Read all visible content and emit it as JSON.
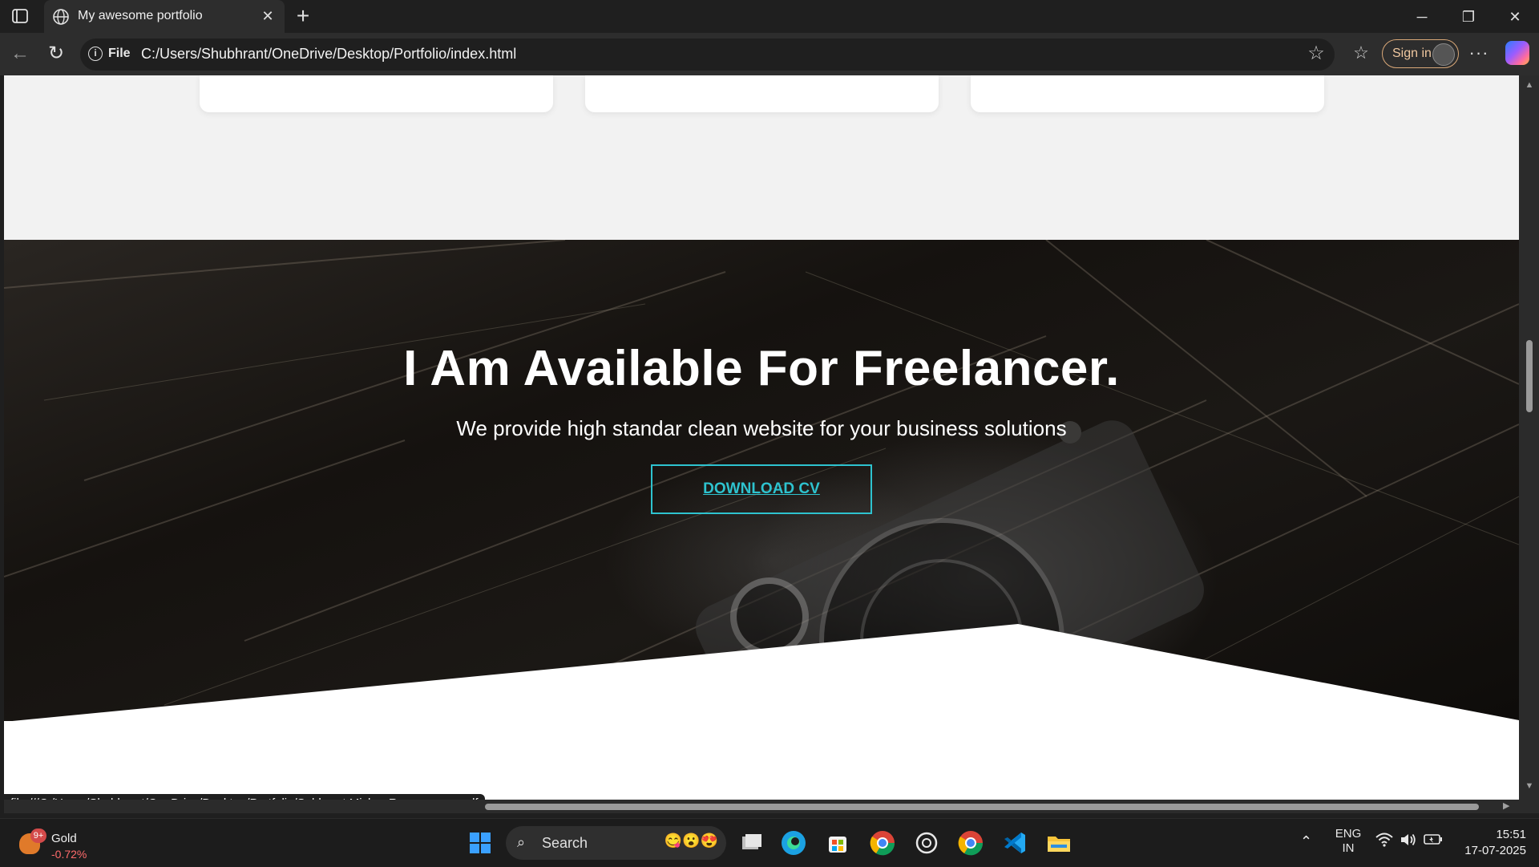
{
  "browser": {
    "tab_title": "My awesome portfolio",
    "address_scheme": "File",
    "address_url": "C:/Users/Shubhrant/OneDrive/Desktop/Portfolio/index.html",
    "signin_label": "Sign in",
    "status_url": "file:///C:/Users/Shubhrant/OneDrive/Desktop/Portfolio/Subhrant Mishra Resume new.pdf"
  },
  "page": {
    "hero_title": "I Am Available For Freelancer.",
    "hero_subtitle": "We provide high standar clean website for your business solutions",
    "cta_label": "DOWNLOAD CV",
    "accent_color": "#2ec3cf"
  },
  "taskbar": {
    "widget_badge": "9+",
    "widget_name": "Gold",
    "widget_change": "-0.72%",
    "search_label": "Search",
    "lang_top": "ENG",
    "lang_bottom": "IN",
    "time": "15:51",
    "date": "17-07-2025",
    "pinned_apps": [
      "start-icon",
      "search",
      "task-view-icon",
      "edge-icon",
      "store-icon",
      "chrome-icon",
      "chatgpt-icon",
      "chrome-profile-icon",
      "vscode-icon",
      "file-explorer-icon"
    ]
  }
}
